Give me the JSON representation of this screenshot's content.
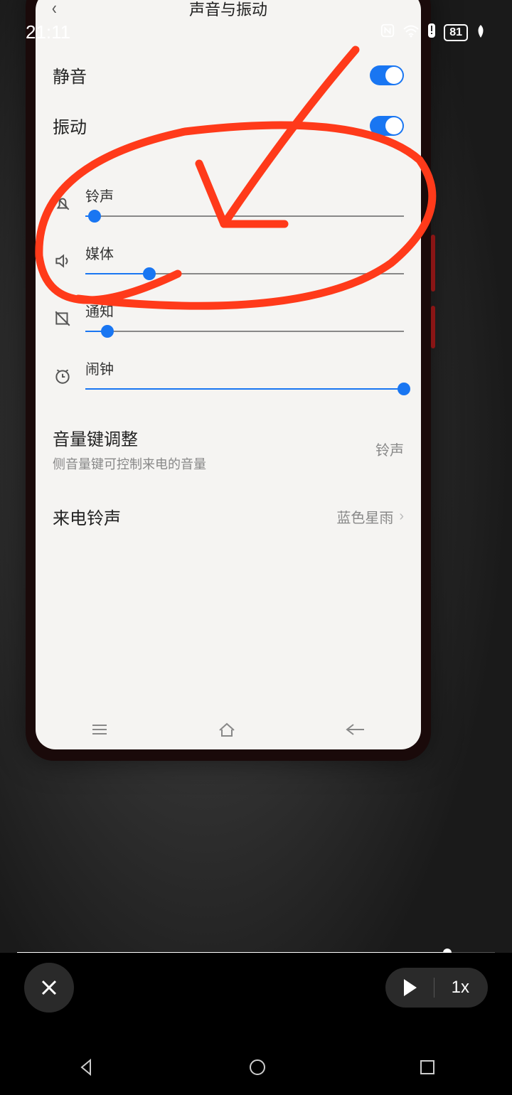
{
  "outer_status": {
    "time": "21:11",
    "battery": "81"
  },
  "page_title": "声音与振动",
  "toggles": {
    "mute": {
      "label": "静音",
      "on": true
    },
    "vibrate": {
      "label": "振动",
      "on": true
    }
  },
  "sliders": {
    "ringtone": {
      "label": "铃声",
      "percent": 3
    },
    "media": {
      "label": "媒体",
      "percent": 20
    },
    "notification": {
      "label": "通知",
      "percent": 7
    },
    "alarm": {
      "label": "闹钟",
      "percent": 100
    }
  },
  "volume_key": {
    "title": "音量键调整",
    "subtitle": "侧音量键可控制来电的音量",
    "value": "铃声"
  },
  "incoming_ring": {
    "title": "来电铃声",
    "value": "蓝色星雨"
  },
  "playback": {
    "speed": "1x"
  }
}
